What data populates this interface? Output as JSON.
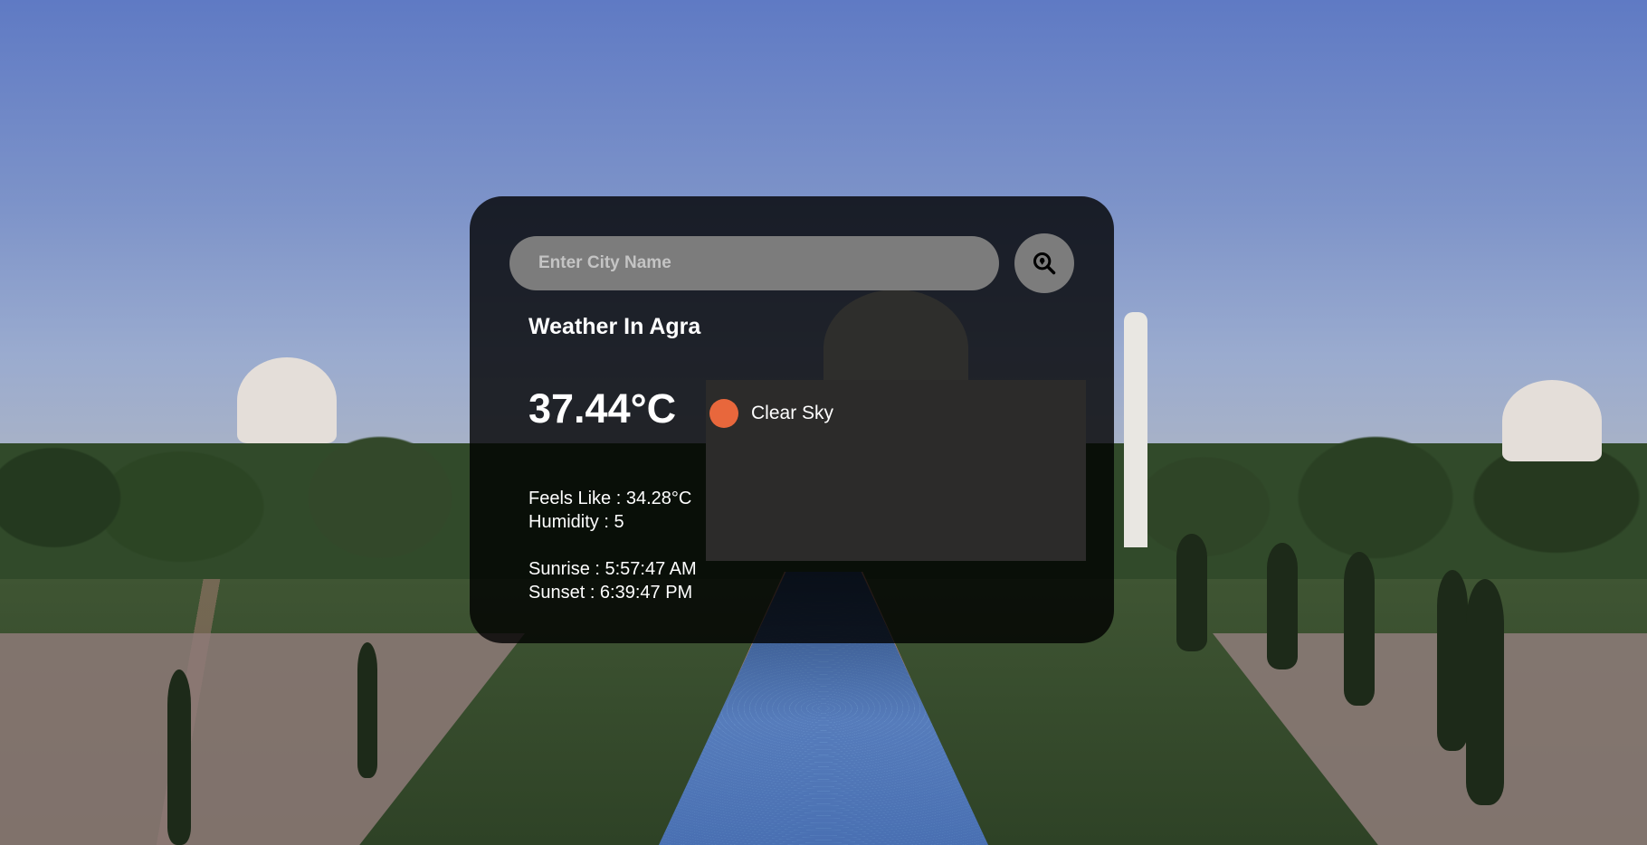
{
  "search": {
    "placeholder": "Enter City Name",
    "button_icon": "location-search-icon"
  },
  "weather": {
    "title": "Weather In Agra",
    "temperature": "37.44°C",
    "condition_icon": "sun-icon",
    "condition_icon_color": "#e8673c",
    "condition": "Clear Sky",
    "feels_like": "Feels Like : 34.28°C",
    "humidity": "Humidity : 5",
    "sunrise": "Sunrise : 5:57:47 AM",
    "sunset": "Sunset : 6:39:47 PM"
  },
  "theme": {
    "card_background": "rgba(0,0,0,0.8)",
    "input_background": "#7c7c7c",
    "text_color": "#ffffff"
  }
}
